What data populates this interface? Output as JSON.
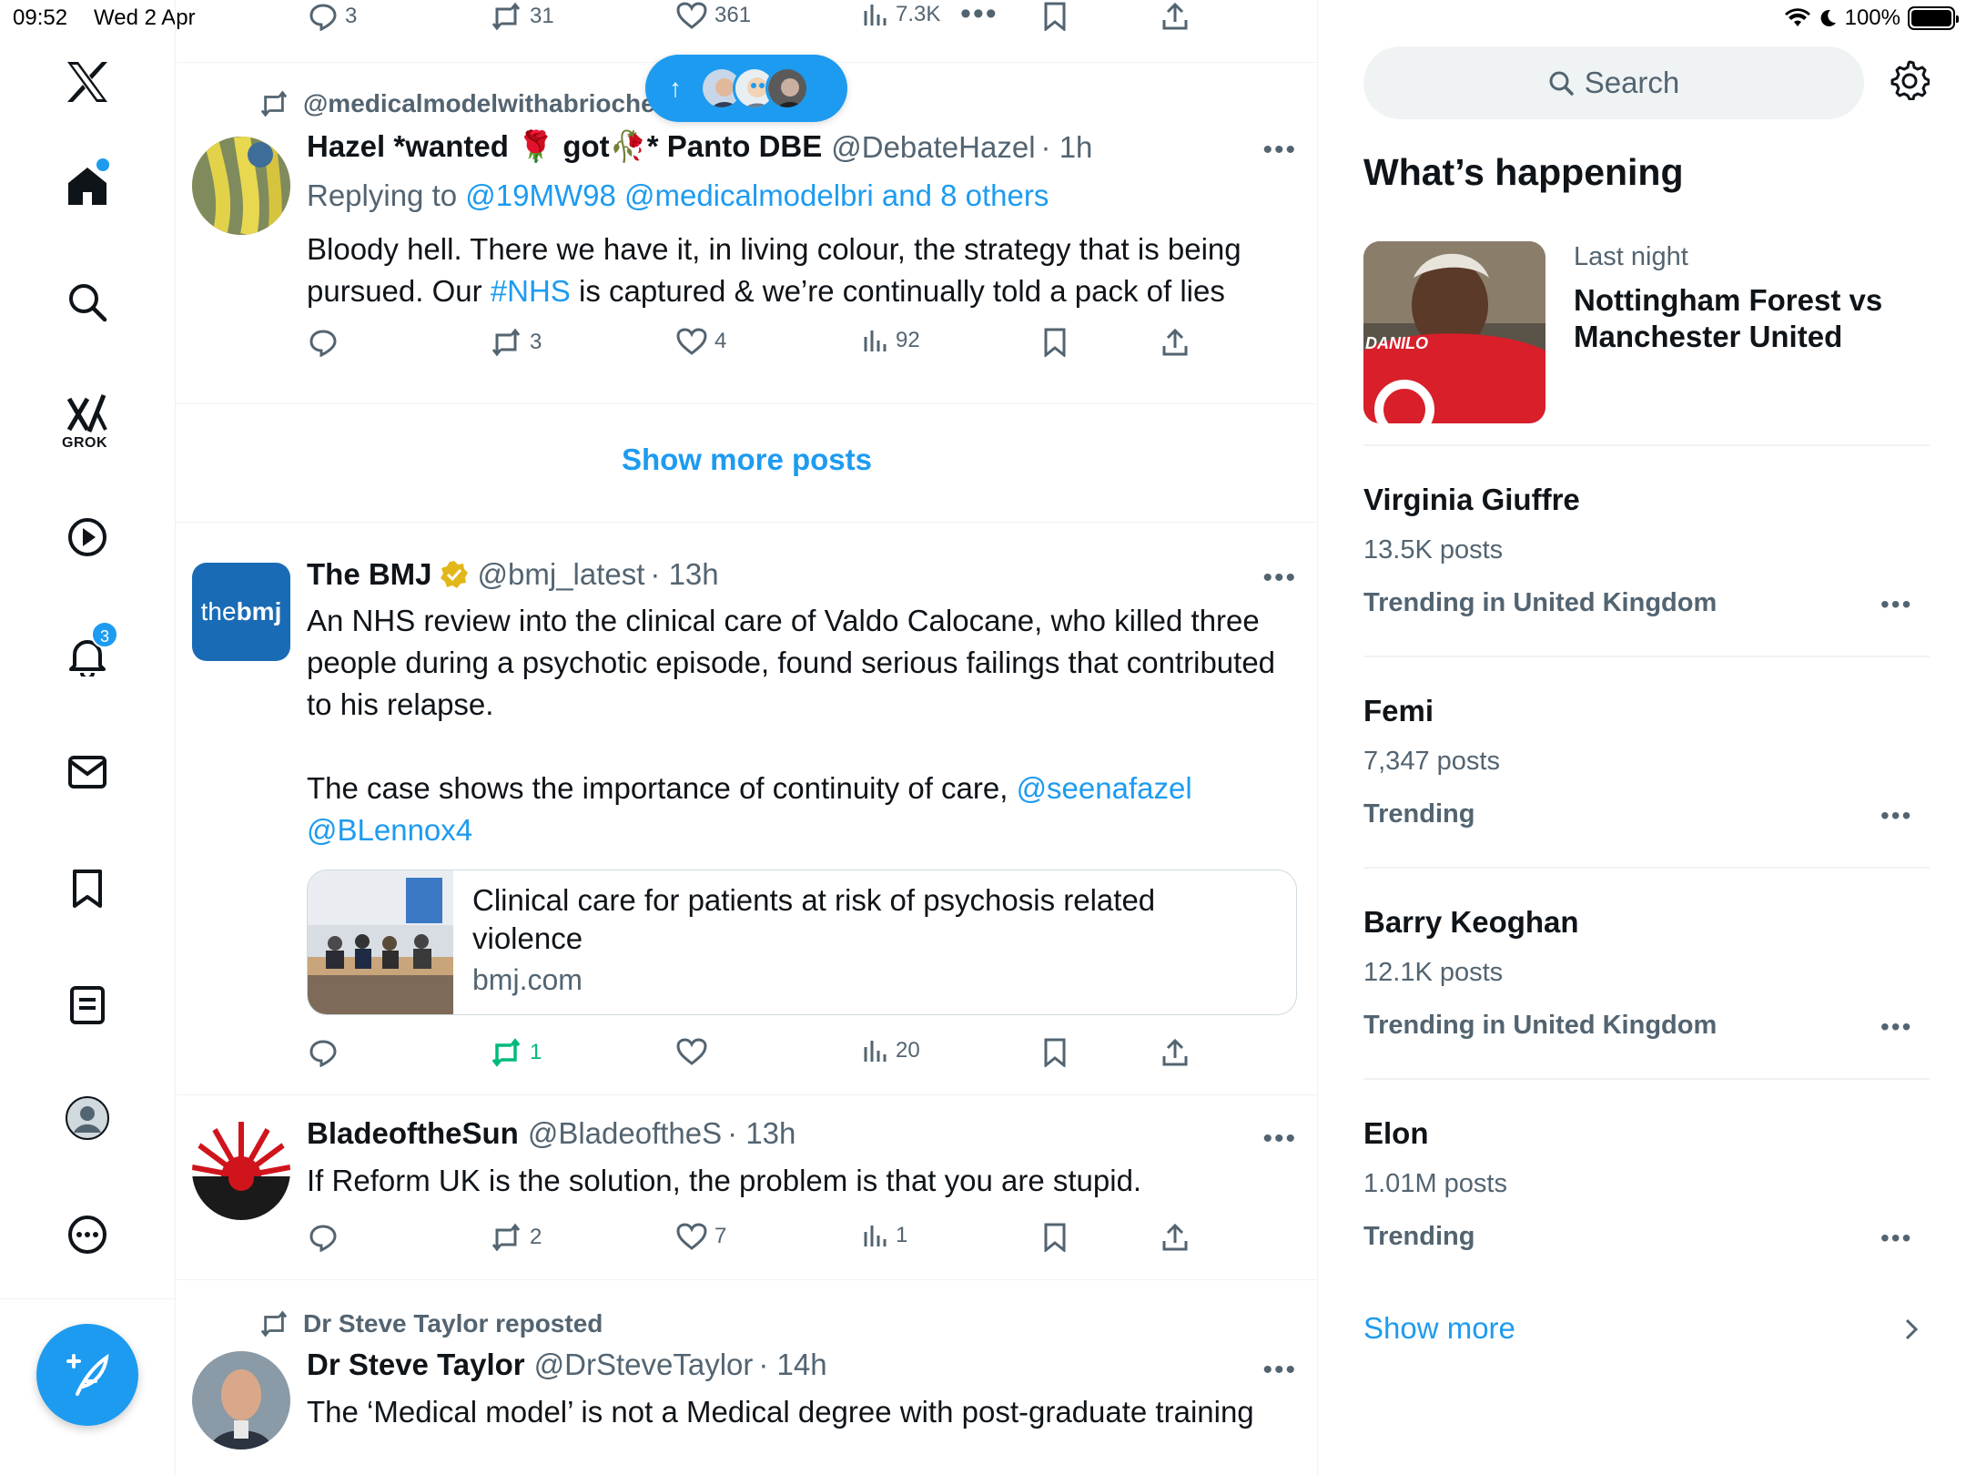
{
  "status": {
    "time": "09:52",
    "date": "Wed 2 Apr",
    "battery": "100%"
  },
  "nav": {
    "items": [
      "x-logo",
      "home",
      "search",
      "grok",
      "video",
      "notifications",
      "messages",
      "bookmarks",
      "lists",
      "profile",
      "more"
    ],
    "grok_label": "GROK",
    "notifications_badge": "3"
  },
  "feed": {
    "top_actions": {
      "replies": "3",
      "reposts": "31",
      "likes": "361",
      "views": "7.3K"
    },
    "new_posts_pill": {
      "arrow": "↑"
    },
    "tweet1": {
      "social_context": "@medicalmodelwithabrioche reposted",
      "name": "Hazel *wanted 🌹 got🥀* Panto DBE",
      "handle": "@DebateHazel",
      "time": "· 1h",
      "replying_prefix": "Replying to ",
      "replying_to": "@19MW98 @medicalmodelbri and 8 others",
      "text_part1": "Bloody hell.  There we have it, in living colour, the strategy that is being pursued.  Our ",
      "hashtag": "#NHS",
      "text_part2": " is captured & we’re continually told a pack of lies",
      "replies": "",
      "reposts": "3",
      "likes": "4",
      "views": "92"
    },
    "show_more_posts": "Show more posts",
    "tweet2": {
      "name": "The BMJ",
      "handle": "@bmj_latest",
      "time": "· 13h",
      "avatar_text_thin": "the",
      "avatar_text_bold": "bmj",
      "text_part1": "An NHS review into the clinical care of Valdo Calocane, who killed three people during a psychotic episode, found serious failings that contributed to his relapse.",
      "text_part2": "The case shows the importance of continuity of care, ",
      "mention1": "@seenafazel",
      "mention2": "@BLennox4",
      "card_title": "Clinical care for patients at risk of psychosis related violence",
      "card_domain": "bmj.com",
      "reposts": "1",
      "likes": "",
      "views": "20"
    },
    "tweet3": {
      "name": "BladeoftheSun",
      "handle": "@BladeoftheS",
      "time": "· 13h",
      "text": "If Reform UK is the solution, the problem is that you are stupid.",
      "reposts": "2",
      "likes": "7",
      "views": "1"
    },
    "tweet4": {
      "social_context": "Dr Steve Taylor reposted",
      "name": "Dr Steve Taylor",
      "handle": "@DrSteveTaylor",
      "time": "· 14h",
      "text": "The ‘Medical model’ is not a  Medical degree with post-graduate training"
    }
  },
  "sidebar": {
    "search_placeholder": "Search",
    "section_title": "What’s happening",
    "featured": {
      "context": "Last night",
      "title": "Nottingham Forest vs Manchester United",
      "shirt_text": "DANILO"
    },
    "trends": [
      {
        "name": "Virginia Giuffre",
        "posts": "13.5K posts",
        "meta": "Trending in United Kingdom"
      },
      {
        "name": "Femi",
        "posts": "7,347 posts",
        "meta": "Trending"
      },
      {
        "name": "Barry Keoghan",
        "posts": "12.1K posts",
        "meta": "Trending in United Kingdom"
      },
      {
        "name": "Elon",
        "posts": "1.01M posts",
        "meta": "Trending"
      }
    ],
    "show_more": "Show more"
  },
  "colors": {
    "accent": "#1d9bf0",
    "text": "#0f1419",
    "muted": "#536471",
    "repost_active": "#00ba7c"
  }
}
